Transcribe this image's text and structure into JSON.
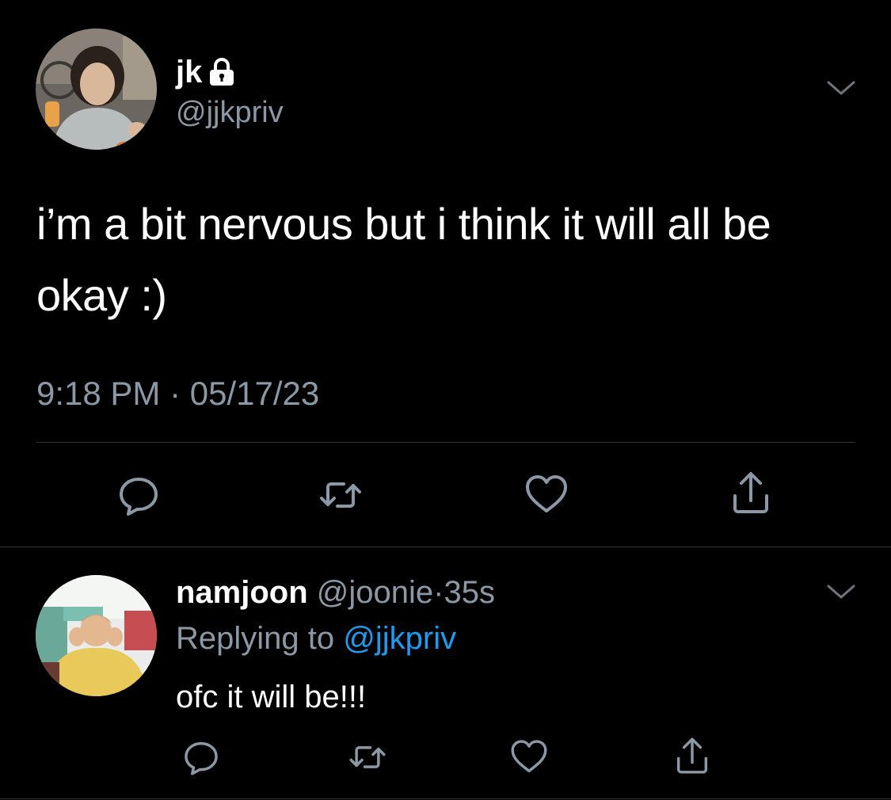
{
  "colors": {
    "background": "#000000",
    "text_primary": "#ffffff",
    "text_secondary": "#8b98a5",
    "link": "#1d9bf0",
    "divider": "#2f3336"
  },
  "main_tweet": {
    "display_name": "jk",
    "handle": "@jjkpriv",
    "protected_icon": "lock-icon",
    "text": "i’m a bit nervous but i think it will all be okay :)",
    "timestamp": "9:18 PM · 05/17/23",
    "actions": [
      "reply-icon",
      "retweet-icon",
      "like-icon",
      "share-icon"
    ]
  },
  "reply_tweet": {
    "display_name": "namjoon",
    "handle": "@joonie",
    "separator": "·",
    "time_ago": "35s",
    "replying_label": "Replying to",
    "replying_handle": "@jjkpriv",
    "text": "ofc it will be!!!",
    "actions": [
      "reply-icon",
      "retweet-icon",
      "like-icon",
      "share-icon"
    ]
  }
}
